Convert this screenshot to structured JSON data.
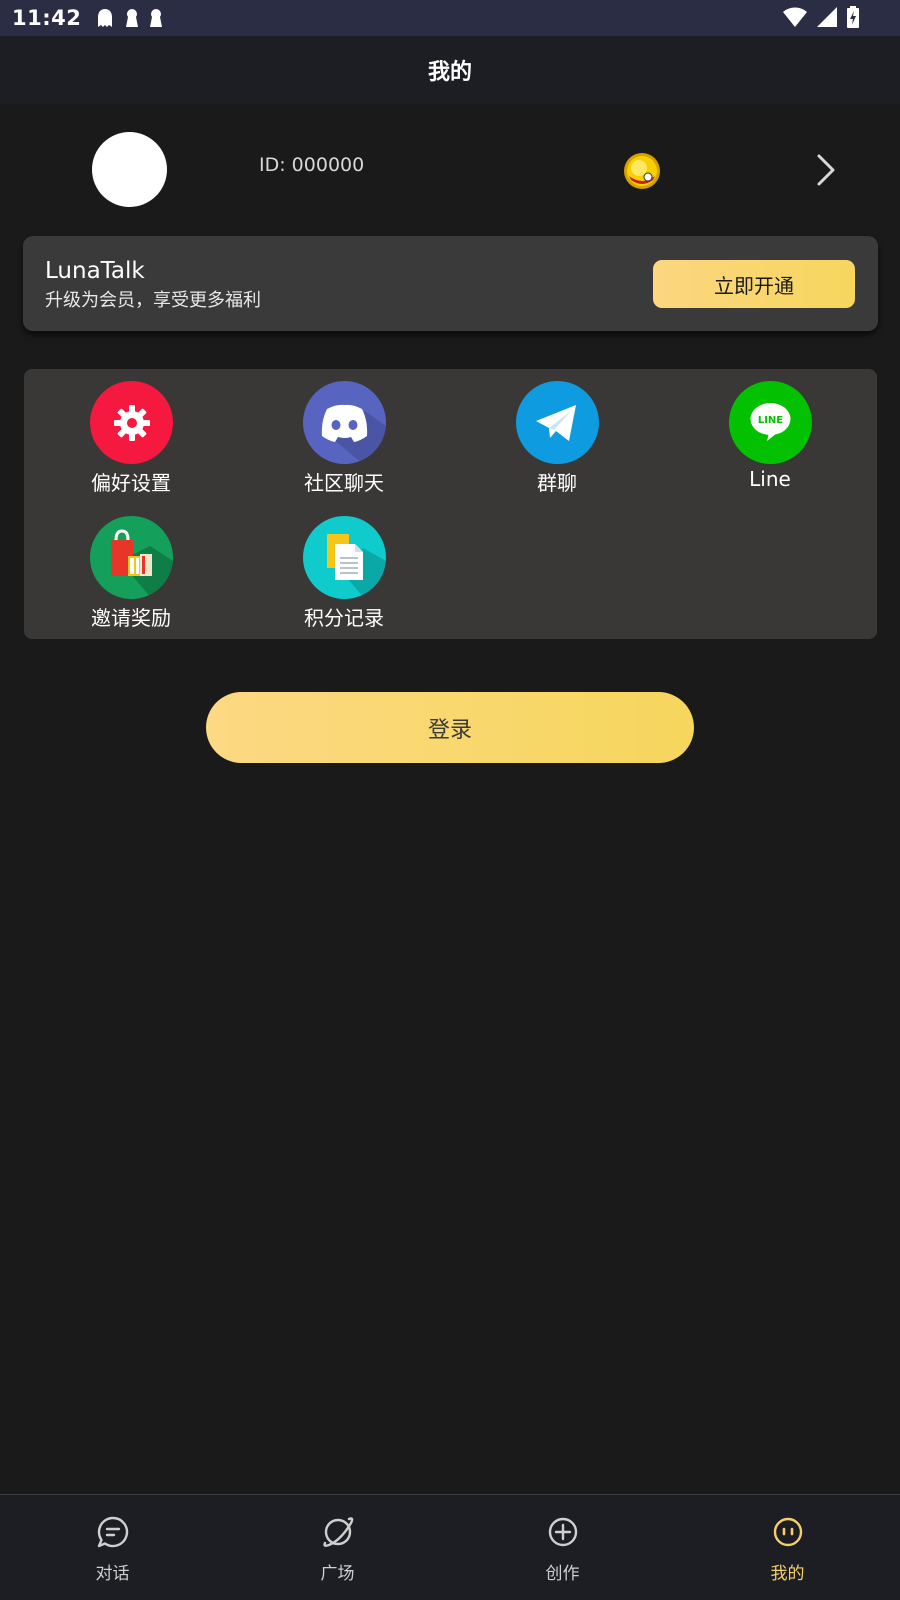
{
  "status_bar": {
    "time": "11:42"
  },
  "header": {
    "title": "我的"
  },
  "profile": {
    "user_id": "ID: 000000"
  },
  "vip_card": {
    "title": "LunaTalk",
    "subtitle": "升级为会员，享受更多福利",
    "button_label": "立即开通"
  },
  "features": [
    {
      "label": "偏好设置",
      "icon": "gear-icon",
      "color": "#f5183f"
    },
    {
      "label": "社区聊天",
      "icon": "discord-icon",
      "color": "#5865c0"
    },
    {
      "label": "群聊",
      "icon": "telegram-icon",
      "color": "#0f9be0"
    },
    {
      "label": "Line",
      "icon": "line-icon",
      "color": "#03c100"
    },
    {
      "label": "邀请奖励",
      "icon": "shopping-bag-icon",
      "color": "#14a05a"
    },
    {
      "label": "积分记录",
      "icon": "document-icon",
      "color": "#0fcbcb"
    }
  ],
  "login": {
    "button_label": "登录"
  },
  "bottom_nav": {
    "items": [
      {
        "label": "对话",
        "icon": "chat-icon"
      },
      {
        "label": "广场",
        "icon": "planet-icon"
      },
      {
        "label": "创作",
        "icon": "plus-circle-icon"
      },
      {
        "label": "我的",
        "icon": "smiley-icon",
        "active": true
      }
    ],
    "accent_color": "#f5cf6a"
  }
}
